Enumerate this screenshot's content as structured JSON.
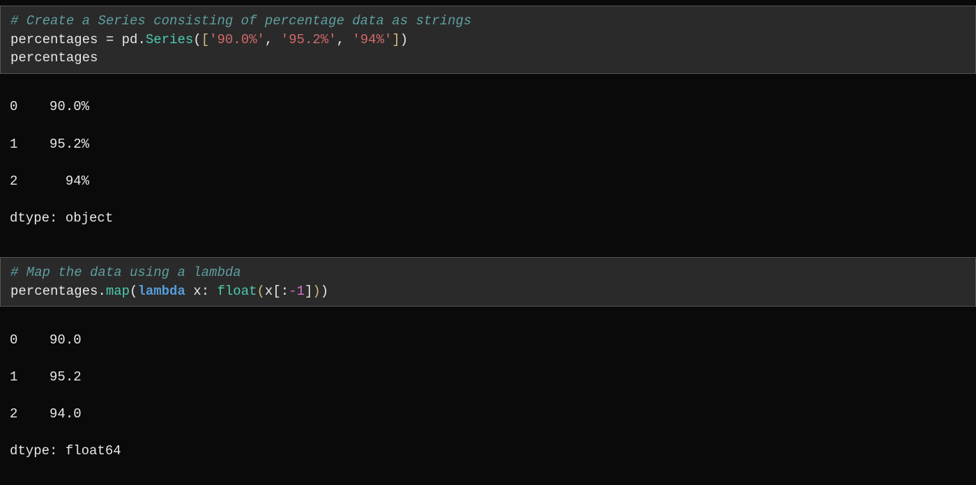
{
  "cells": [
    {
      "type": "code",
      "comment": "# Create a Series consisting of percentage data as strings",
      "line2": {
        "assign_target": "percentages",
        "module": "pd",
        "class": "Series",
        "args": [
          "'90.0%'",
          "'95.2%'",
          "'94%'"
        ]
      },
      "line3": "percentages"
    },
    {
      "type": "output",
      "lines": [
        "0    90.0%",
        "1    95.2%",
        "2      94%",
        "dtype: object"
      ]
    },
    {
      "type": "code",
      "comment": "# Map the data using a lambda",
      "line2": {
        "target": "percentages",
        "method": "map",
        "lambda_kw": "lambda",
        "lambda_arg": "x",
        "builtin": "float",
        "slice_expr": "x[:",
        "slice_num": "-1",
        "slice_close": "]"
      }
    },
    {
      "type": "output",
      "lines": [
        "0    90.0",
        "1    95.2",
        "2    94.0",
        "dtype: float64"
      ]
    }
  ]
}
